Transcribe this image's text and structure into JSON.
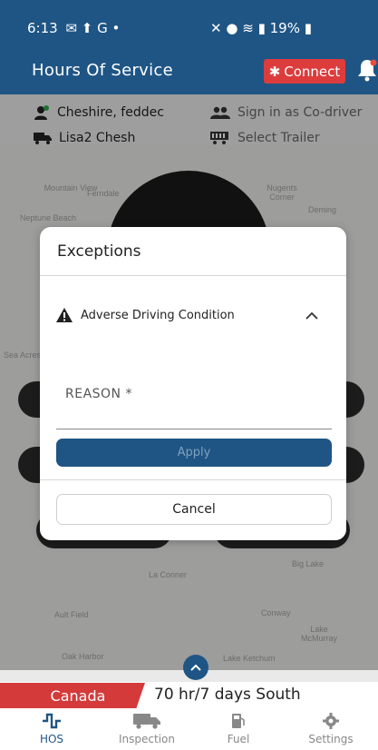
{
  "status_bar": {
    "time": "6:13",
    "left_icons": "✉ ⬆ G •",
    "battery": "19%"
  },
  "header": {
    "title": "Hours Of Service",
    "connect_label": "Connect"
  },
  "info": {
    "driver": "Cheshire, feddec",
    "co_driver": "Sign in as Co-driver",
    "vehicle": "Lisa2 Chesh",
    "trailer": "Select Trailer"
  },
  "map": {
    "labels": [
      "Mountain View",
      "Ferndale",
      "Nugents Corner",
      "Deming",
      "Neptune Beach",
      "Sea Acres",
      "La Conner",
      "Big Lake",
      "Ault Field",
      "Conway",
      "Lake McMurray",
      "Oak Harbor",
      "Lake Ketchum"
    ]
  },
  "dialog": {
    "title": "Exceptions",
    "exception_label": "Adverse Driving Condition",
    "reason_placeholder": "REASON *",
    "apply_label": "Apply",
    "cancel_label": "Cancel"
  },
  "region": {
    "country": "Canada",
    "cycle": "70 hr/7 days South"
  },
  "nav": [
    {
      "label": "HOS",
      "icon": "hos-icon",
      "active": true
    },
    {
      "label": "Inspection",
      "icon": "truck-icon",
      "active": false
    },
    {
      "label": "Fuel",
      "icon": "fuel-icon",
      "active": false
    },
    {
      "label": "Settings",
      "icon": "gear-icon",
      "active": false
    }
  ],
  "colors": {
    "primary": "#1f5584",
    "accent": "#dc3c3c",
    "region": "#d43a3a"
  }
}
